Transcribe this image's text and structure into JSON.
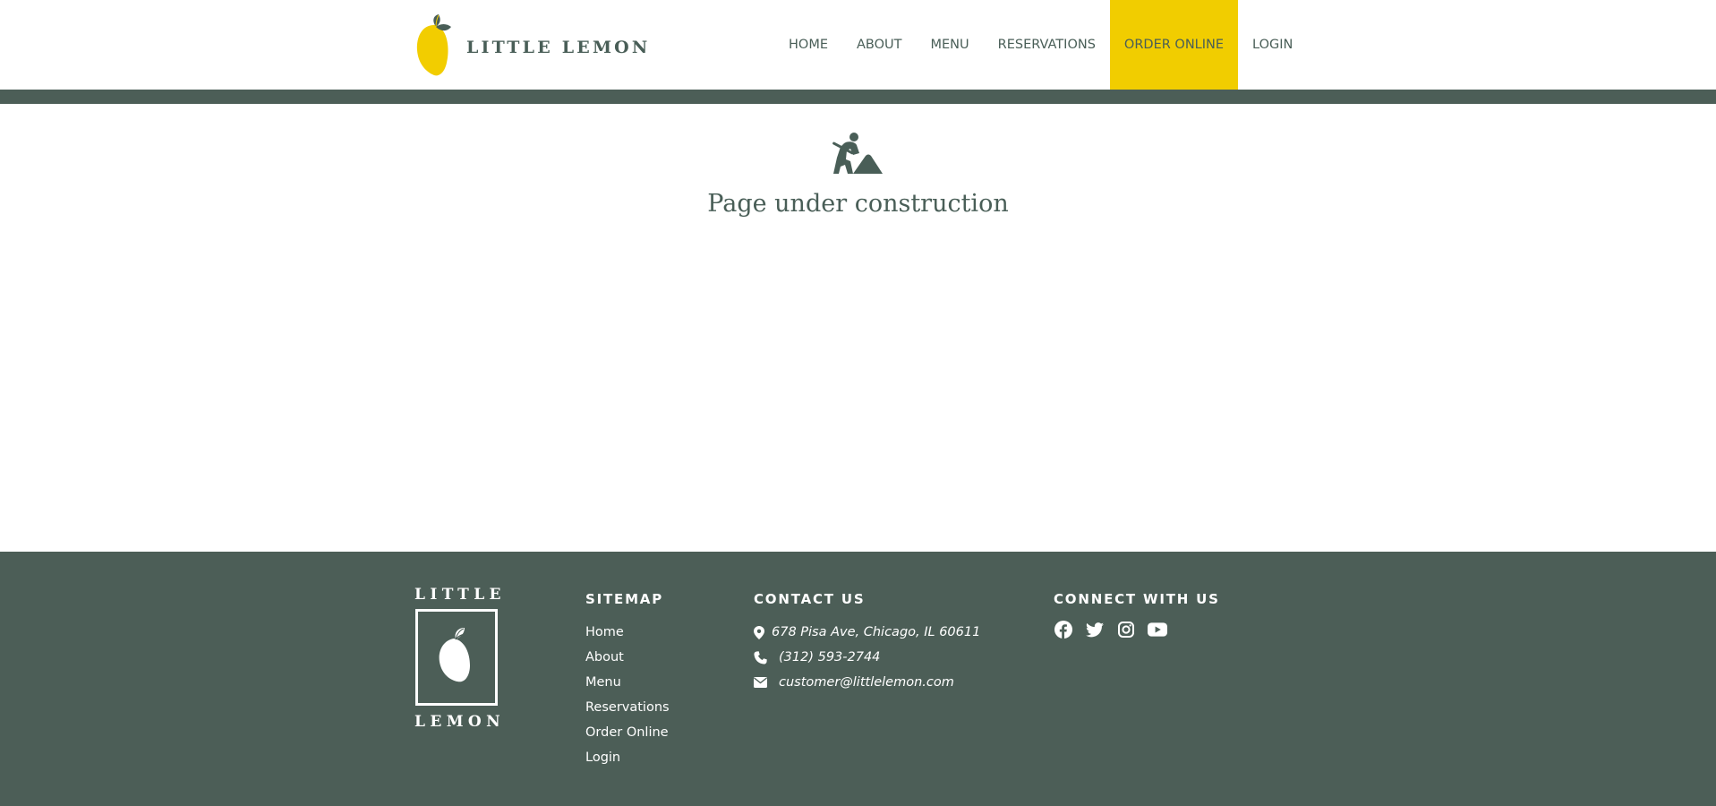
{
  "header": {
    "brand_name": "LITTLE LEMON",
    "nav": [
      {
        "label": "HOME",
        "active": false
      },
      {
        "label": "ABOUT",
        "active": false
      },
      {
        "label": "MENU",
        "active": false
      },
      {
        "label": "RESERVATIONS",
        "active": false
      },
      {
        "label": "ORDER ONLINE",
        "active": true
      },
      {
        "label": "LOGIN",
        "active": false
      }
    ]
  },
  "main": {
    "icon": "person-digging-icon",
    "title": "Page under construction"
  },
  "footer": {
    "logo_top": "LITTLE",
    "logo_bottom": "LEMON",
    "sitemap": {
      "heading": "SITEMAP",
      "links": [
        "Home",
        "About",
        "Menu",
        "Reservations",
        "Order Online",
        "Login"
      ]
    },
    "contact": {
      "heading": "CONTACT US",
      "address": "678 Pisa Ave, Chicago, IL 60611",
      "phone": "(312) 593-2744",
      "email": "customer@littlelemon.com"
    },
    "connect": {
      "heading": "CONNECT WITH US",
      "icons": [
        "facebook-icon",
        "twitter-icon",
        "instagram-icon",
        "youtube-icon"
      ]
    }
  },
  "colors": {
    "primary_green": "#495e57",
    "accent_yellow": "#f1cd00",
    "footer_bg": "#4c5e57",
    "white": "#ffffff"
  }
}
